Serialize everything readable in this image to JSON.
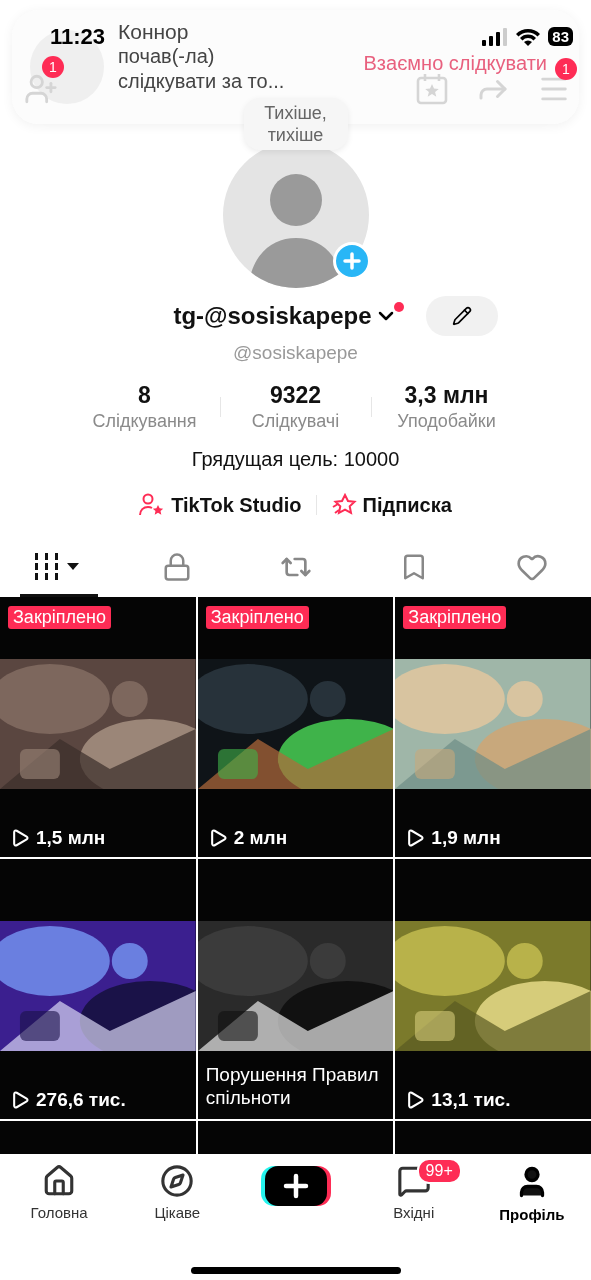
{
  "status_bar": {
    "time": "11:23",
    "battery": "83"
  },
  "notification": {
    "name": "Коннор",
    "message_lines": [
      "почав(-ла)",
      "слідкувати за то..."
    ],
    "action": "Взаємно слідкувати"
  },
  "header": {
    "friends_badge": "1",
    "menu_badge": "1"
  },
  "note": "Тихіше, тихіше",
  "profile": {
    "display_name": "tg-@sosiskapepe",
    "new_dot": true,
    "handle": "@sosiskapepe",
    "stats": [
      {
        "value": "8",
        "label": "Слідкування"
      },
      {
        "value": "9322",
        "label": "Слідкувачі"
      },
      {
        "value": "3,3 млн",
        "label": "Уподобайки"
      }
    ],
    "goal": "Грядущая цель: 10000",
    "links": [
      {
        "kind": "studio",
        "label": "TikTok Studio"
      },
      {
        "kind": "subscription",
        "label": "Підписка"
      }
    ]
  },
  "tabs": [
    {
      "kind": "videos",
      "selected": true
    },
    {
      "kind": "private",
      "selected": false
    },
    {
      "kind": "reposts",
      "selected": false
    },
    {
      "kind": "saved",
      "selected": false
    },
    {
      "kind": "liked",
      "selected": false
    }
  ],
  "videos": [
    {
      "kind": "video",
      "badge": "Закріплено",
      "views": "1,5 млн"
    },
    {
      "kind": "video",
      "badge": "Закріплено",
      "views": "2 млн"
    },
    {
      "kind": "video",
      "badge": "Закріплено",
      "views": "1,9 млн"
    },
    {
      "kind": "video",
      "views": "276,6 тис."
    },
    {
      "kind": "notice",
      "notice": "Порушення Правил спільноти"
    },
    {
      "kind": "video",
      "views": "13,1 тис."
    },
    {
      "kind": "cut"
    },
    {
      "kind": "cut"
    },
    {
      "kind": "cut"
    }
  ],
  "nav": [
    {
      "kind": "home",
      "label": "Головна",
      "selected": false
    },
    {
      "kind": "explore",
      "label": "Цікаве",
      "selected": false
    },
    {
      "kind": "create"
    },
    {
      "kind": "inbox",
      "label": "Вхідні",
      "badge": "99+",
      "selected": false
    },
    {
      "kind": "profile",
      "label": "Профіль",
      "selected": true
    }
  ]
}
